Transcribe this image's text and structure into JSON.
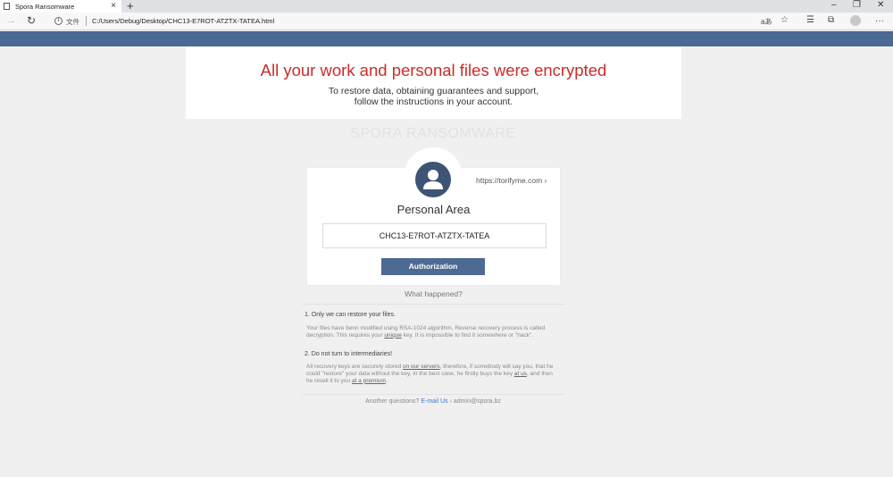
{
  "browser": {
    "tab_title": "Spora Ransomware",
    "tab_close": "×",
    "new_tab": "+",
    "file_label": "文件",
    "url": "C:/Users/Debug/Desktop/CHC13-E7ROT-ATZTX-TATEA.html",
    "read_aloud": "aあ",
    "window_minimize": "–",
    "window_restore": "❐",
    "window_close": "✕",
    "more": "···"
  },
  "hero": {
    "title": "All your work and personal files were encrypted",
    "line1": "To restore data, obtaining guarantees and support,",
    "line2": "follow the instructions in your account."
  },
  "brand": "SPORA RANSOMWARE",
  "card": {
    "link": "https://torifyme.com ›",
    "title": "Personal Area",
    "code": "CHC13-E7ROT-ATZTX-TATEA",
    "button": "Authorization"
  },
  "what_happened": "What happened?",
  "section1": {
    "heading": "1. Only we can restore your files.",
    "text_a": "Your files have benn modified using RSA-1024 algorithm. Reverse recovery process is called decryption. This requires your ",
    "text_u": "unique",
    "text_b": " key. It is impossible to find it somewhere or \"hack\"."
  },
  "section2": {
    "heading": "2. Do not turn to intermediaries!",
    "text_a": "All recovery keys are securely stored ",
    "text_u1": "on our servers",
    "text_b": ", therefore, if somebody will say you, that he could \"restore\" your data without the key, in the best case, he firstly buys the key ",
    "text_u2": "at us",
    "text_c": ", and then he resell it to you ",
    "text_u3": "at a premium",
    "text_d": "."
  },
  "footer": {
    "prefix": "Another questions? ",
    "email_label": "E-mail Us",
    "suffix": " › admin@spora.bz"
  }
}
